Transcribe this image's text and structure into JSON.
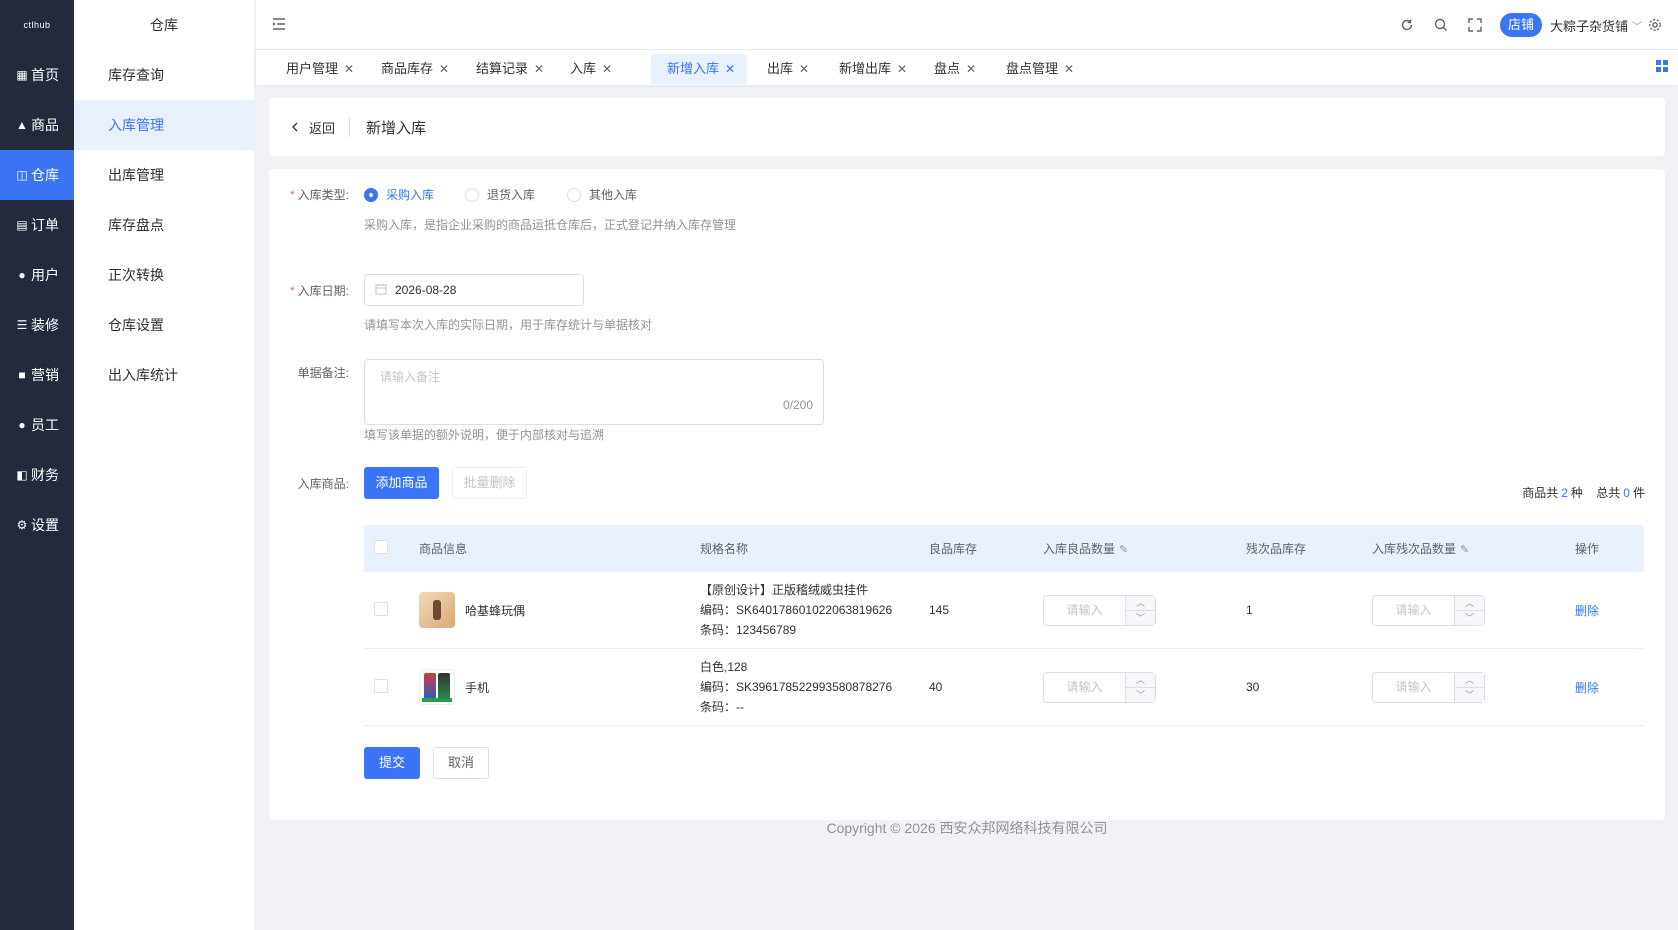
{
  "app": {
    "logo_text": "ctlhub",
    "colors": {
      "accent": "#3c74f6",
      "sidebar_bg": "#222a3b",
      "danger": "#f56c6c"
    }
  },
  "rail": {
    "items": [
      {
        "label": "首页",
        "icon": "grid-icon"
      },
      {
        "label": "商品",
        "icon": "bag-icon"
      },
      {
        "label": "仓库",
        "icon": "warehouse-icon"
      },
      {
        "label": "订单",
        "icon": "clipboard-icon"
      },
      {
        "label": "用户",
        "icon": "user-icon"
      },
      {
        "label": "装修",
        "icon": "sliders-icon"
      },
      {
        "label": "营销",
        "icon": "chat-icon"
      },
      {
        "label": "员工",
        "icon": "user-icon"
      },
      {
        "label": "财务",
        "icon": "wallet-icon"
      },
      {
        "label": "设置",
        "icon": "gear-icon"
      }
    ],
    "active_index": 2
  },
  "submenu": {
    "title": "仓库",
    "items": [
      "库存查询",
      "入库管理",
      "出库管理",
      "库存盘点",
      "正次转换",
      "仓库设置",
      "出入库统计"
    ],
    "active_index": 1
  },
  "header": {
    "store_badge": "店铺",
    "store_name": "大粽子杂货铺"
  },
  "tabs": [
    "用户管理",
    "商品库存",
    "结算记录",
    "入库",
    "新增入库",
    "出库",
    "新增出库",
    "盘点",
    "盘点管理"
  ],
  "page": {
    "back_label": "返回",
    "title": "新增入库"
  },
  "form": {
    "type_label": "入库类型:",
    "type_options": [
      "采购入库",
      "退货入库",
      "其他入库"
    ],
    "type_selected": 0,
    "type_hint": "采购入库，是指企业采购的商品运抵仓库后，正式登记并纳入库存管理",
    "date_label": "入库日期:",
    "date_value": "2026-08-28",
    "date_hint": "请填写本次入库的实际日期，用于库存统计与单据核对",
    "remark_label": "单据备注:",
    "remark_placeholder": "请输入备注",
    "remark_count": "0/200",
    "remark_hint": "填写该单据的额外说明，便于内部核对与追溯",
    "goods_label": "入库商品:",
    "add_button": "添加商品",
    "batch_delete_button": "批量删除",
    "summary_prefix": "商品共",
    "summary_kinds": "2",
    "summary_kinds_unit": "种",
    "summary_total_prefix": "总共",
    "summary_total": "0",
    "summary_total_unit": "件",
    "submit_button": "提交",
    "cancel_button": "取消"
  },
  "table": {
    "headers": [
      "商品信息",
      "规格名称",
      "良品库存",
      "入库良品数量",
      "残次品库存",
      "入库残次品数量",
      "操作"
    ],
    "rows": [
      {
        "name": "哈基蜂玩偶",
        "spec": "【原创设计】正版稽绒威虫挂件",
        "code": "编码：SK6401786010220638196​26",
        "barcode": "条码：123456789",
        "good_stock": "145",
        "defect_stock": "1",
        "qty_placeholder": "请输入",
        "action": "删除"
      },
      {
        "name": "手机",
        "spec": "白色,128",
        "code": "编码：SK3961785229935808782​76",
        "barcode": "条码：--",
        "good_stock": "40",
        "defect_stock": "30",
        "qty_placeholder": "请输入",
        "action": "删除"
      }
    ]
  },
  "footer": {
    "copyright": "Copyright © 2026 西安众邦网络科技有限公司"
  }
}
